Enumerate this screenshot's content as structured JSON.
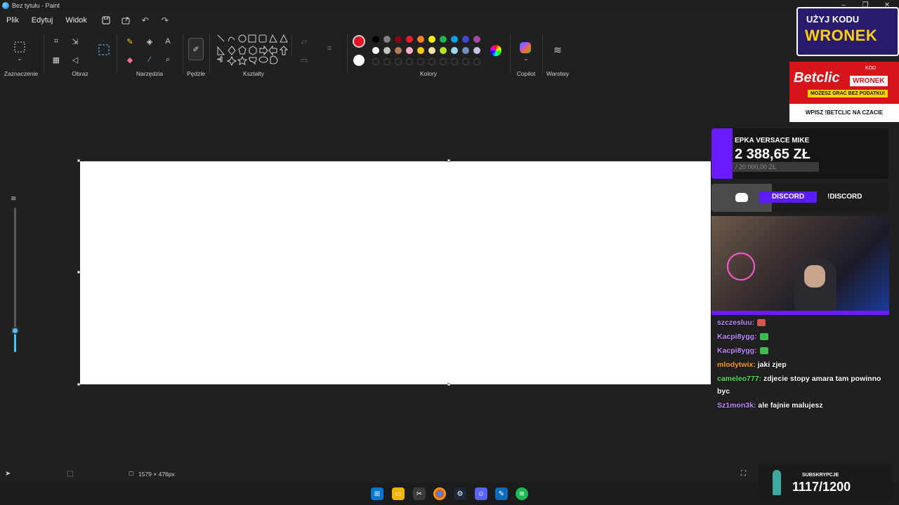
{
  "window": {
    "title": "Bez tytułu - Paint"
  },
  "menu": {
    "items": [
      "Plik",
      "Edytuj",
      "Widok"
    ]
  },
  "ribbon": {
    "groups": {
      "selection": "Zaznaczenie",
      "image": "Obraz",
      "tools": "Narzędzia",
      "brushes": "Pędzle",
      "shapes": "Kształty",
      "colors": "Kolory",
      "copilot": "Copilot",
      "layers": "Warstwy"
    },
    "active_color": "#e81123",
    "palette_row1": [
      "#000000",
      "#7f7f7f",
      "#880015",
      "#ed1c24",
      "#ff7f27",
      "#fff200",
      "#22b14c",
      "#00a2e8",
      "#3f48cc",
      "#a349a4"
    ],
    "palette_row2": [
      "#ffffff",
      "#c3c3c3",
      "#b97a57",
      "#ffaec9",
      "#ffc90e",
      "#efe4b0",
      "#b5e61d",
      "#99d9ea",
      "#7092be",
      "#c8bfe7"
    ]
  },
  "status": {
    "canvas_size": "1579 × 476px"
  },
  "overlay": {
    "ad1_line1": "UŻYJ KODU",
    "ad1_line2": "WRONEK",
    "ad2_logo": "Betclic",
    "ad2_kod": "KOD",
    "ad2_code": "WRONEK",
    "ad2_promo": "MOŻESZ GRAĆ BEZ PODATKU!",
    "ad2_bottom": "WPISZ !BETCLIC NA CZACIE",
    "donation_title": "EPKA VERSACE MIKE",
    "donation_amount": "2 388,65 ZŁ",
    "donation_goal": "/ 20 000,00 ZŁ",
    "discord_label": "DISCORD",
    "discord_cmd": "!DISCORD",
    "chat": [
      {
        "user": "szczesluu:",
        "color": "#c08aff",
        "msg": ""
      },
      {
        "user": "Kacpi8ygg:",
        "color": "#c08aff",
        "msg": ""
      },
      {
        "user": "Kacpi8ygg:",
        "color": "#c08aff",
        "msg": ""
      },
      {
        "user": "mlodytwix:",
        "color": "#ff9f1a",
        "msg": "jaki zjep"
      },
      {
        "user": "cameleo777:",
        "color": "#52e052",
        "msg": "zdjecie stopy amara tam powinno byc"
      },
      {
        "user": "Sz1mon3k:",
        "color": "#c08aff",
        "msg": "ale fajnie malujesz"
      }
    ],
    "subs_label": "SUBSKRYPCJE",
    "subs_count": "1117/1200"
  }
}
